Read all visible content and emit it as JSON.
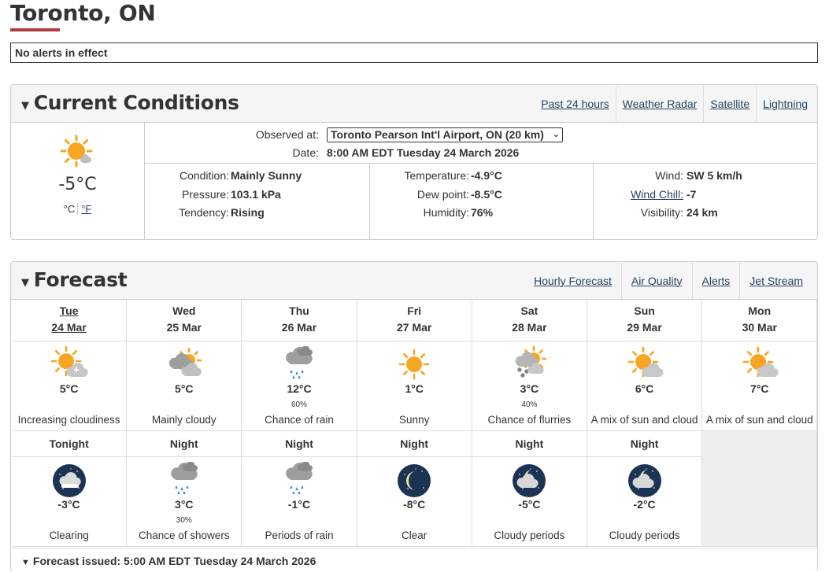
{
  "city": "Toronto, ON",
  "alerts": "No alerts in effect",
  "colors": {
    "accent_bar": "#af3c43",
    "link": "#284162",
    "sun": "#f6a623",
    "night_icon": "#1d3354"
  },
  "current": {
    "title": "Current Conditions",
    "links": [
      "Past 24 hours",
      "Weather Radar",
      "Satellite",
      "Lightning"
    ],
    "icon": "sunny-icon",
    "temp": "-5°C",
    "unit_c": "°C",
    "unit_f": "°F",
    "observed_label": "Observed at:",
    "station": "Toronto Pearson Int'l Airport, ON (20 km)",
    "date_label": "Date:",
    "date": "8:00 AM EDT Tuesday 24 March 2026",
    "col1": [
      {
        "label": "Condition:",
        "value": "Mainly Sunny"
      },
      {
        "label": "Pressure:",
        "value": "103.1 kPa"
      },
      {
        "label": "Tendency:",
        "value": "Rising"
      }
    ],
    "col2": [
      {
        "label": "Temperature:",
        "value": "-4.9°C"
      },
      {
        "label": "Dew point:",
        "value": "-8.5°C"
      },
      {
        "label": "Humidity:",
        "value": "76%"
      }
    ],
    "col3": [
      {
        "label": "Wind:",
        "value": "SW 5 km/h"
      },
      {
        "label": "Wind Chill:",
        "value": "-7"
      },
      {
        "label": "Visibility:",
        "value": "24 km"
      }
    ]
  },
  "forecast": {
    "title": "Forecast",
    "links": [
      "Hourly Forecast",
      "Air Quality",
      "Alerts",
      "Jet Stream"
    ],
    "days": [
      {
        "name": "Tue",
        "date": "24 Mar",
        "icon": "sun-cloud-increasing-icon",
        "temp": "5°C",
        "pop": "",
        "summary": "Increasing cloudiness"
      },
      {
        "name": "Wed",
        "date": "25 Mar",
        "icon": "mainly-cloudy-icon",
        "temp": "5°C",
        "pop": "",
        "summary": "Mainly cloudy"
      },
      {
        "name": "Thu",
        "date": "26 Mar",
        "icon": "rain-icon",
        "temp": "12°C",
        "pop": "60%",
        "summary": "Chance of rain"
      },
      {
        "name": "Fri",
        "date": "27 Mar",
        "icon": "sunny-icon",
        "temp": "1°C",
        "pop": "",
        "summary": "Sunny"
      },
      {
        "name": "Sat",
        "date": "28 Mar",
        "icon": "flurries-icon",
        "temp": "3°C",
        "pop": "40%",
        "summary": "Chance of flurries"
      },
      {
        "name": "Sun",
        "date": "29 Mar",
        "icon": "sun-cloud-icon",
        "temp": "6°C",
        "pop": "",
        "summary": "A mix of sun and cloud"
      },
      {
        "name": "Mon",
        "date": "30 Mar",
        "icon": "sun-cloud-icon",
        "temp": "7°C",
        "pop": "",
        "summary": "A mix of sun and cloud"
      }
    ],
    "nights": [
      {
        "name": "Tonight",
        "icon": "clear-night-cloud-icon",
        "temp": "-3°C",
        "pop": "",
        "summary": "Clearing"
      },
      {
        "name": "Night",
        "icon": "showers-icon",
        "temp": "3°C",
        "pop": "30%",
        "summary": "Chance of showers"
      },
      {
        "name": "Night",
        "icon": "rain-icon",
        "temp": "-1°C",
        "pop": "",
        "summary": "Periods of rain"
      },
      {
        "name": "Night",
        "icon": "clear-night-icon",
        "temp": "-8°C",
        "pop": "",
        "summary": "Clear"
      },
      {
        "name": "Night",
        "icon": "cloudy-night-icon",
        "temp": "-5°C",
        "pop": "",
        "summary": "Cloudy periods"
      },
      {
        "name": "Night",
        "icon": "cloudy-night-icon",
        "temp": "-2°C",
        "pop": "",
        "summary": "Cloudy periods"
      }
    ],
    "issued": "Forecast issued: 5:00 AM EDT Tuesday 24 March 2026"
  }
}
